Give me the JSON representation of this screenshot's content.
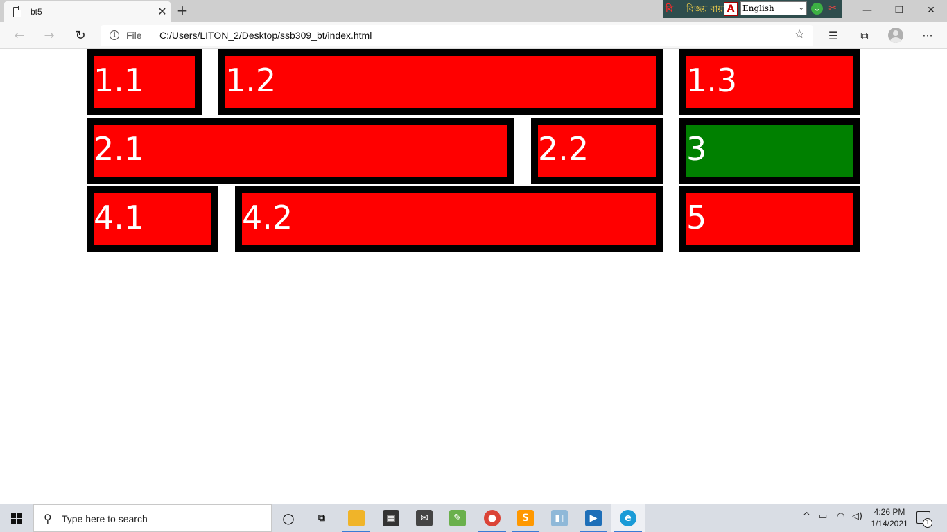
{
  "browser": {
    "tab_title": "bt5",
    "tab_close": "✕",
    "new_tab": "+",
    "scheme_label": "File",
    "url": "C:/Users/LITON_2/Desktop/ssb309_bt/index.html",
    "ime": {
      "label": "বিজয় বায়ান্নো",
      "language": "English"
    },
    "window_controls": {
      "minimize": "—",
      "restore": "❐",
      "close": "✕"
    }
  },
  "page": {
    "boxes": [
      {
        "label": "1.1",
        "color": "#ff0000"
      },
      {
        "label": "1.2",
        "color": "#ff0000"
      },
      {
        "label": "1.3",
        "color": "#ff0000"
      },
      {
        "label": "2.1",
        "color": "#ff0000"
      },
      {
        "label": "2.2",
        "color": "#ff0000"
      },
      {
        "label": "3",
        "color": "#008000"
      },
      {
        "label": "4.1",
        "color": "#ff0000"
      },
      {
        "label": "4.2",
        "color": "#ff0000"
      },
      {
        "label": "5",
        "color": "#ff0000"
      }
    ]
  },
  "taskbar": {
    "search_placeholder": "Type here to search",
    "time": "4:26 PM",
    "date": "1/14/2021",
    "notification_count": "1",
    "apps": [
      "cortana-icon",
      "task-view-icon",
      "file-explorer-icon",
      "store-icon",
      "mail-icon",
      "notepad-icon",
      "chrome-icon",
      "sublime-icon",
      "app-icon",
      "media-icon",
      "edge-icon"
    ]
  }
}
